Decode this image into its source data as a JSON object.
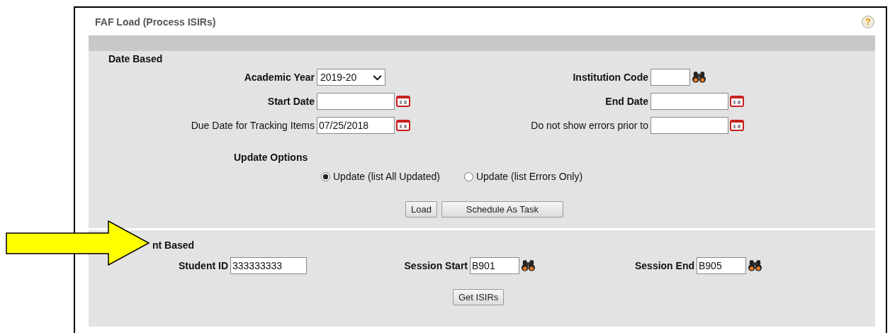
{
  "window": {
    "title": "FAF Load (Process ISIRs)",
    "help": "?"
  },
  "date_section": {
    "title": "Date Based",
    "fields": [
      {
        "kind": "select",
        "label": "Academic Year",
        "bold": true,
        "value": "2019-20"
      },
      {
        "kind": "lookup",
        "label": "Institution Code",
        "bold": true
      },
      {
        "kind": "date",
        "label": "Start Date",
        "bold": true
      },
      {
        "kind": "date",
        "label": "End Date",
        "bold": true
      },
      {
        "kind": "date",
        "label": "Due Date for Tracking Items",
        "bold": false,
        "value": "07/25/2018"
      },
      {
        "kind": "date",
        "label": "Do not show errors prior to",
        "bold": false
      }
    ],
    "update_options": {
      "label": "Update Options",
      "options": [
        {
          "label": "Update (list All Updated)",
          "selected": true
        },
        {
          "label": "Update (list Errors Only)",
          "selected": false
        }
      ]
    },
    "buttons": [
      "Load",
      "Schedule As Task"
    ]
  },
  "student_section": {
    "title": "nt Based",
    "fields": [
      {
        "kind": "text",
        "label": "Student ID",
        "bold": true,
        "value": "333333333"
      },
      {
        "kind": "lookup",
        "label": "Session Start",
        "bold": true,
        "value": "B901"
      },
      {
        "kind": "lookup",
        "label": "Session End",
        "bold": true,
        "value": "B905"
      }
    ],
    "buttons": [
      "Get ISIRs"
    ]
  }
}
